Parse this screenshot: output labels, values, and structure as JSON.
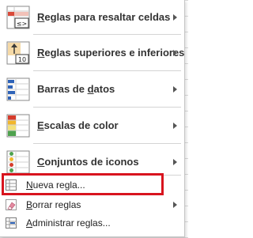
{
  "menu": {
    "items": [
      {
        "label_pre": "",
        "label_ul": "R",
        "label_post": "eglas para resaltar celdas",
        "icon": "highlight-cells-rules-icon",
        "submenu": true
      },
      {
        "label_pre": "",
        "label_ul": "R",
        "label_post": "eglas superiores e inferiores",
        "icon": "top-bottom-rules-icon",
        "submenu": true
      },
      {
        "label_pre": "Barras de ",
        "label_ul": "d",
        "label_post": "atos",
        "icon": "data-bars-icon",
        "submenu": true
      },
      {
        "label_pre": "",
        "label_ul": "E",
        "label_post": "scalas de color",
        "icon": "color-scales-icon",
        "submenu": true
      },
      {
        "label_pre": "",
        "label_ul": "C",
        "label_post": "onjuntos de iconos",
        "icon": "icon-sets-icon",
        "submenu": true
      }
    ],
    "commands": [
      {
        "label_pre": "",
        "label_ul": "N",
        "label_post": "ueva regla...",
        "icon": "new-rule-icon",
        "submenu": false
      },
      {
        "label_pre": "",
        "label_ul": "B",
        "label_post": "orrar reglas",
        "icon": "clear-rules-icon",
        "submenu": true
      },
      {
        "label_pre": "",
        "label_ul": "A",
        "label_post": "dministrar reglas...",
        "icon": "manage-rules-icon",
        "submenu": false
      }
    ],
    "icon_texts": {
      "highlight_rule_glyph": "≤>",
      "top_bottom_number": "10"
    }
  },
  "colors": {
    "highlight_border": "#d8141e",
    "accent_blue": "#2e63b8",
    "accent_red": "#d63b2b",
    "accent_green": "#4ea24e",
    "accent_yellow": "#f2b62b"
  }
}
